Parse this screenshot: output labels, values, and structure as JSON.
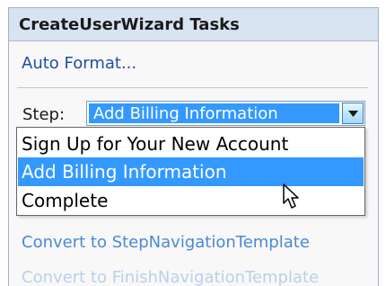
{
  "panel": {
    "title": "CreateUserWizard Tasks",
    "auto_format_label": "Auto Format...",
    "step_label": "Step:",
    "step_selected": "Add Billing Information",
    "options": [
      "Sign Up for Your New Account",
      "Add Billing Information",
      "Complete"
    ],
    "selected_index": 1,
    "links": [
      "Convert to StepNavigationTemplate",
      "Convert to FinishNavigationTemplate"
    ]
  },
  "icons": {
    "dropdown_arrow": "chevron-down-icon",
    "cursor": "mouse-pointer-icon"
  },
  "colors": {
    "header_background": "#d8e3f2",
    "selection": "#3399ff",
    "link": "#4a8ad2",
    "link_faded": "#b8d0ec"
  }
}
